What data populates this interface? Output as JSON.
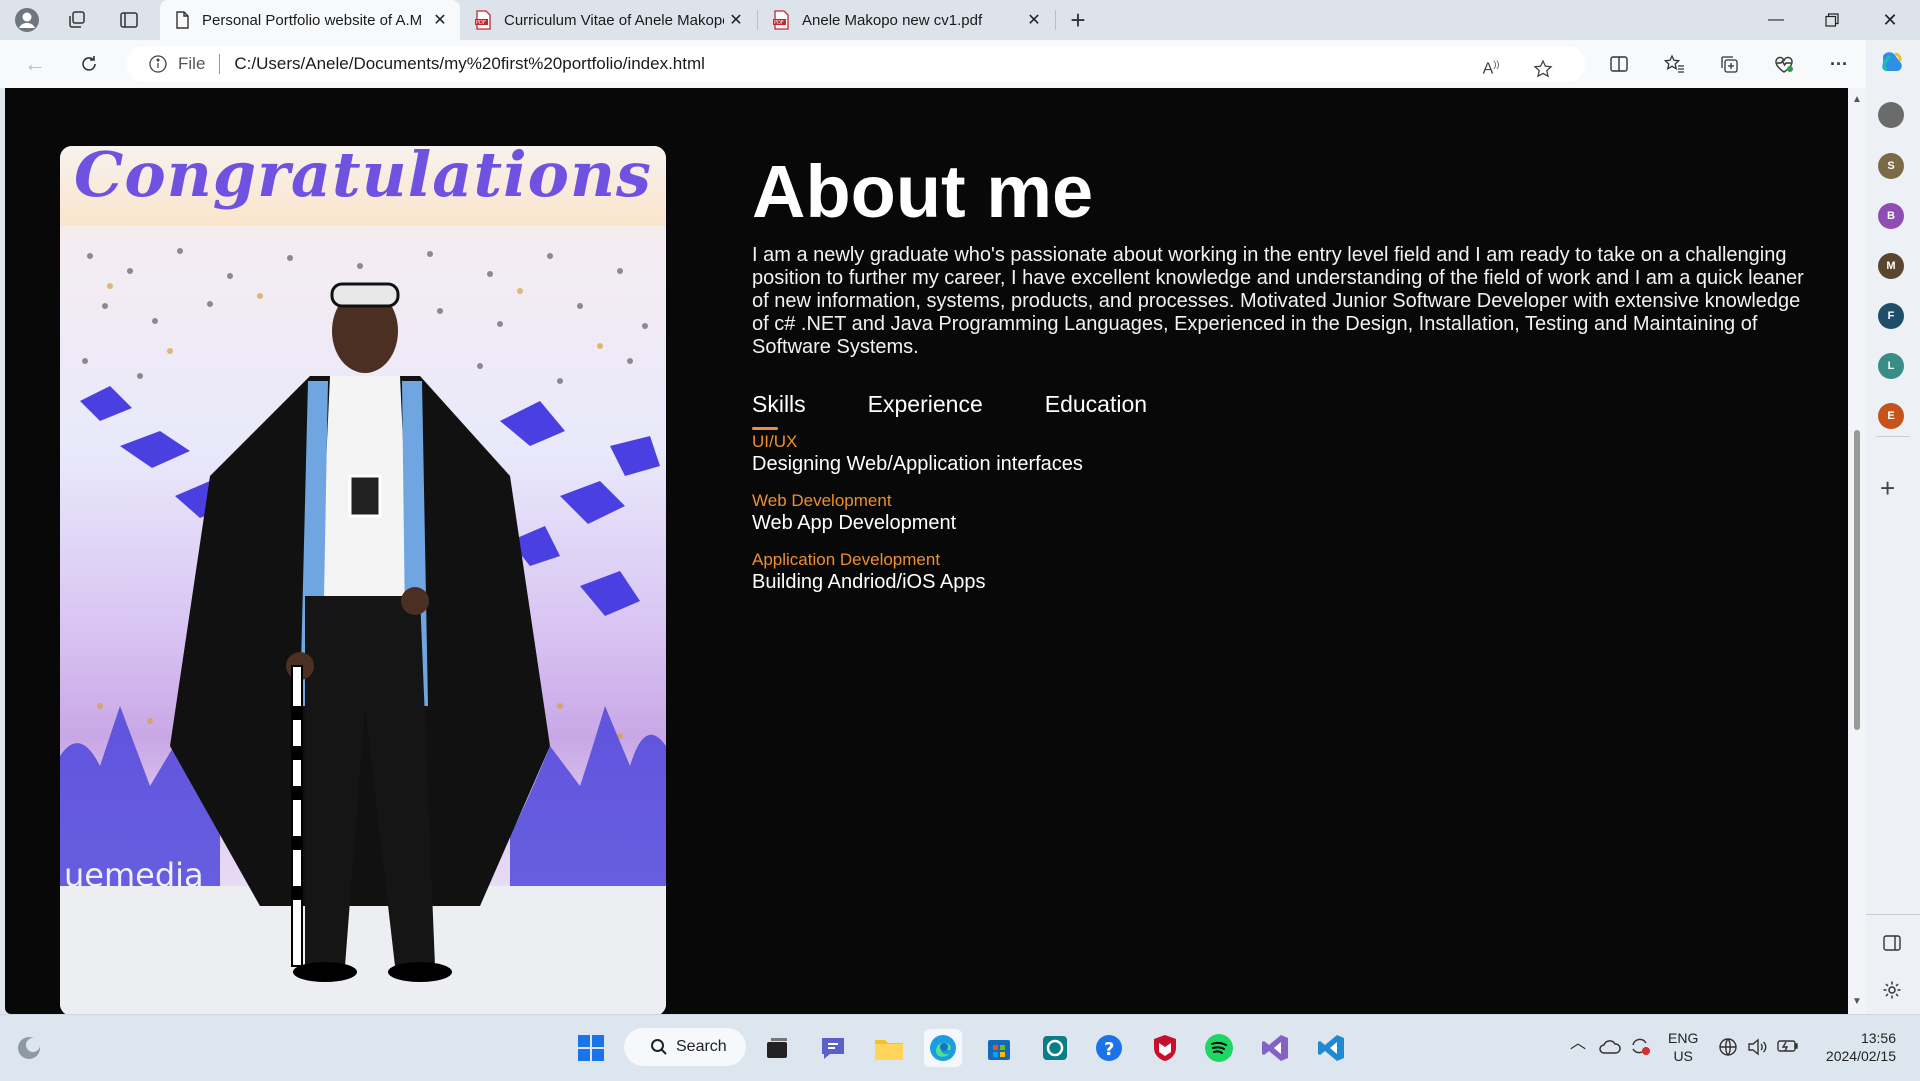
{
  "browser": {
    "tabs": [
      {
        "title": "Personal Portfolio website of A.M",
        "icon": "page-icon",
        "active": true
      },
      {
        "title": "Curriculum Vitae of Anele Makopo",
        "icon": "pdf-icon",
        "active": false
      },
      {
        "title": "Anele Makopo new cv1.pdf",
        "icon": "pdf-icon",
        "active": false
      }
    ],
    "address": {
      "scheme_label": "File",
      "url": "C:/Users/Anele/Documents/my%20first%20portfolio/index.html"
    }
  },
  "page": {
    "photo": {
      "banner_text": "Congratulations"
    },
    "about": {
      "heading": "About me",
      "paragraph": "I am a newly graduate who's passionate about working in the entry level field and I am ready to take on a challenging position to further my career, I have excellent knowledge and understanding of the field of work and I am a quick leaner of new information, systems, products, and processes. Motivated Junior Software Developer with extensive knowledge of c# .NET and Java Programming Languages, Experienced in the Design, Installation, Testing and Maintaining of Software Systems."
    },
    "tab_links": [
      {
        "label": "Skills",
        "active": true
      },
      {
        "label": "Experience",
        "active": false
      },
      {
        "label": "Education",
        "active": false
      }
    ],
    "skills": [
      {
        "title": "UI/UX",
        "desc": "Designing Web/Application interfaces"
      },
      {
        "title": "Web Development",
        "desc": "Web App Development"
      },
      {
        "title": "Application Development",
        "desc": "Building Andriod/iOS Apps"
      }
    ],
    "accent_color": "#ef8f2c"
  },
  "sidebar": {
    "profiles": [
      {
        "letter": "",
        "color": "#6b6b6b"
      },
      {
        "letter": "S",
        "color": "#7a6a45"
      },
      {
        "letter": "B",
        "color": "#8e4db0"
      },
      {
        "letter": "M",
        "color": "#5a4630"
      },
      {
        "letter": "F",
        "color": "#1f4e6b"
      },
      {
        "letter": "L",
        "color": "#3a8c86"
      },
      {
        "letter": "E",
        "color": "#c4541c"
      }
    ]
  },
  "taskbar": {
    "search_label": "Search",
    "language": "ENG",
    "region": "US",
    "time": "13:56",
    "date": "2024/02/15"
  }
}
